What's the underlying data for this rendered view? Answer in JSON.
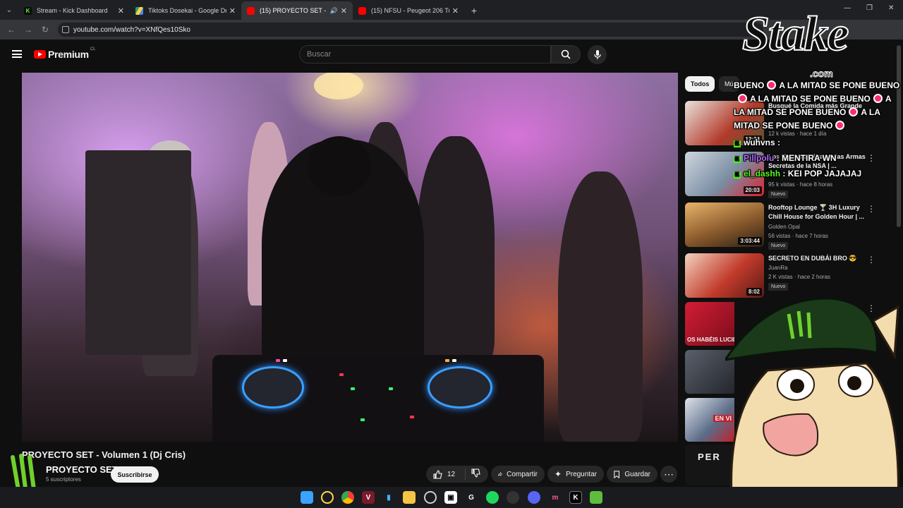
{
  "browser": {
    "tabs": [
      {
        "title": "Stream - Kick Dashboard",
        "favicon": "kick-icon",
        "color": "#53fc18",
        "active": false
      },
      {
        "title": "Tiktoks Dosekai - Google Drive",
        "favicon": "google-drive-icon",
        "color": "#1fa463",
        "active": false
      },
      {
        "title": "(15) PROYECTO SET - Volum",
        "favicon": "youtube-icon",
        "color": "#ff0000",
        "active": true,
        "audio": true
      },
      {
        "title": "(15) NFSU - Peugeot 206 Tuning",
        "favicon": "youtube-icon",
        "color": "#ff0000",
        "active": false
      }
    ],
    "url": "youtube.com/watch?v=XNfQes10Sko"
  },
  "youtube": {
    "logo_text": "Premium",
    "country_code": "CL",
    "search_placeholder": "Buscar"
  },
  "video": {
    "title": "PROYECTO SET - Volumen 1 (Dj Cris)",
    "channel": "PROYECTO SET",
    "subscribers": "5 suscriptores",
    "subscribe_label": "Suscribirse",
    "likes": "12",
    "share_label": "Compartir",
    "ask_label": "Preguntar",
    "save_label": "Guardar"
  },
  "rail": {
    "chips": [
      "Todos",
      "Mú"
    ],
    "items": [
      {
        "title": "Busqué la Comida más Grande",
        "channel": "",
        "meta": "12 k vistas · hace 1 día",
        "duration": "12:34",
        "badge": "",
        "thumb": "#b23a2a"
      },
      {
        "title": "Los Hackers Filtraron las Armas Secretas de la NSA | ...",
        "channel": "",
        "meta": "95 k vistas · hace 8 horas",
        "duration": "20:03",
        "badge": "Nuevo",
        "thumb": "#7a8ea3"
      },
      {
        "title": "Rooftop Lounge 🍸 3H Luxury Chill House for Golden Hour | ...",
        "channel": "Golden Opal",
        "meta": "56 vistas · hace 7 horas",
        "duration": "3:03:44",
        "badge": "Nuevo",
        "thumb": "#8a5a2c"
      },
      {
        "title": "SECRETO EN DUBÁI BRO 😎",
        "channel": "JuanRa",
        "meta": "2 K vistas · hace 2 horas",
        "duration": "8:02",
        "badge": "Nuevo",
        "thumb": "#c23b2b"
      }
    ],
    "extra_thumbs": [
      {
        "label": "OS HABÉIS LUCIDO",
        "color": "#b3182a"
      },
      {
        "label": "",
        "color": "#3a3f48"
      },
      {
        "label": "EN VI",
        "color": "#5b6c88"
      },
      {
        "label": "PER",
        "color": "#1a1a1a"
      }
    ]
  },
  "overlay": {
    "stake_logo": "Stake",
    "stake_domain": ".com",
    "chat_lines": [
      {
        "user": "",
        "text": "BUENO"
      },
      {
        "user": "",
        "text": "A LA MITAD SE PONE BUENO"
      },
      {
        "user": "",
        "text": "A LA MITAD SE PONE BUENO"
      },
      {
        "user": "",
        "text": "A"
      },
      {
        "user": "",
        "text": "LA MITAD SE PONE BUENO"
      },
      {
        "user": "",
        "text": "A LA"
      },
      {
        "user": "",
        "text": "MITAD SE PONE BUENO"
      },
      {
        "user": "wuhvns",
        "text": ":"
      },
      {
        "user": "Pillpolu",
        "text": ": MENTIRA WN"
      },
      {
        "user": "el_dashh",
        "text": ": KEI POP JAJAJAJ"
      }
    ],
    "sponsor_text": "MONSTER",
    "sponsor_sub": "ENERGY"
  },
  "taskbar": {
    "icons": [
      "windows-start-icon",
      "app-icon",
      "chrome-icon",
      "app-icon",
      "app-icon",
      "file-explorer-icon",
      "app-icon",
      "app-icon",
      "app-icon",
      "spotify-icon",
      "app-icon",
      "discord-icon",
      "app-icon",
      "kick-icon",
      "app-icon"
    ]
  }
}
